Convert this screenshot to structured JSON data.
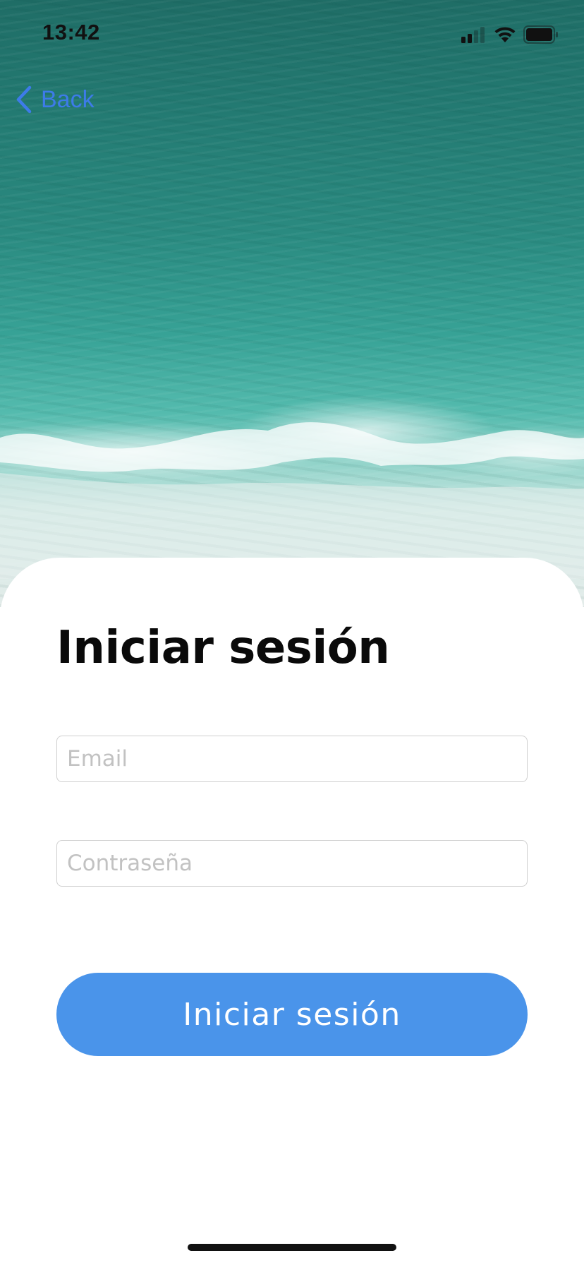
{
  "status_bar": {
    "time": "13:42",
    "icons": [
      "cellular-signal-icon",
      "wifi-icon",
      "battery-icon"
    ]
  },
  "nav": {
    "back_label": "Back",
    "back_icon": "chevron-left-icon"
  },
  "login": {
    "title": "Iniciar sesión",
    "email_placeholder": "Email",
    "password_placeholder": "Contraseña",
    "submit_label": "Iniciar sesión"
  },
  "colors": {
    "accent": "#4a94ea",
    "link": "#3d7be9",
    "title": "#0a0a0a",
    "placeholder": "#c2c2c2",
    "field_border": "#cfcfcf"
  }
}
